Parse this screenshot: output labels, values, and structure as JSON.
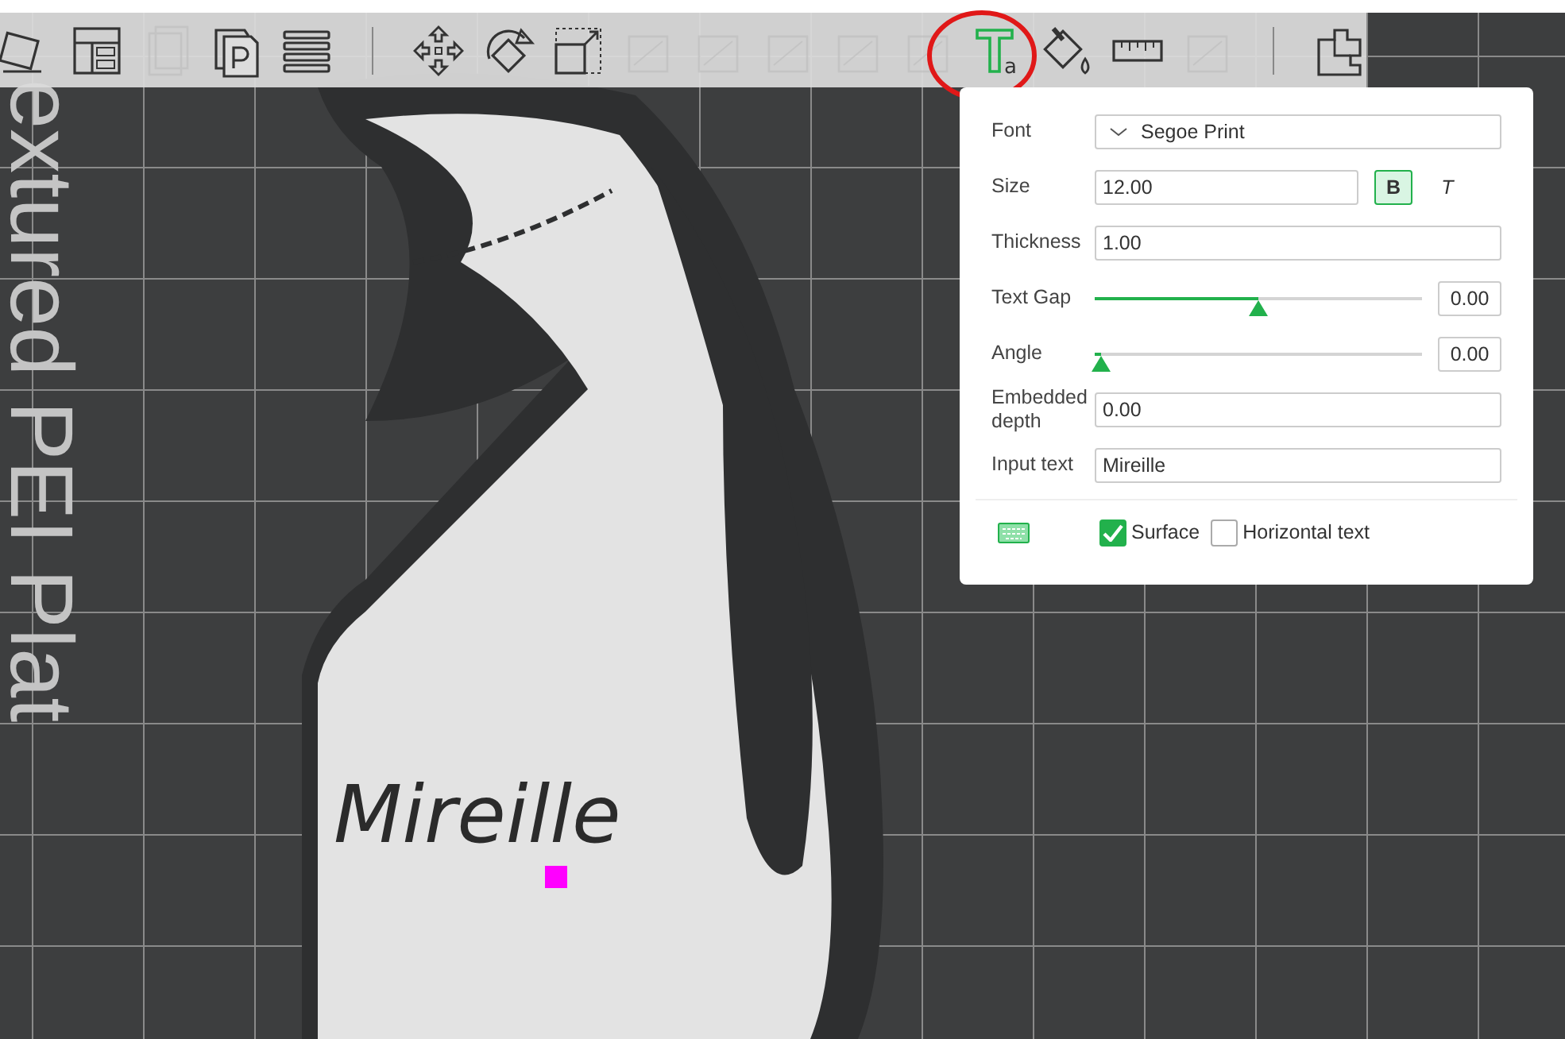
{
  "toolbar": {
    "items": [
      {
        "kind": "tilt",
        "disabled": false,
        "selected": false
      },
      {
        "kind": "layout",
        "disabled": false,
        "selected": false
      },
      {
        "kind": "copy",
        "disabled": true,
        "selected": false
      },
      {
        "kind": "plate",
        "disabled": false,
        "selected": false
      },
      {
        "kind": "layers",
        "disabled": false,
        "selected": false
      },
      {
        "kind": "separator"
      },
      {
        "kind": "move",
        "disabled": false,
        "selected": false
      },
      {
        "kind": "rotate",
        "disabled": false,
        "selected": false
      },
      {
        "kind": "scale",
        "disabled": false,
        "selected": false
      },
      {
        "kind": "flatten",
        "disabled": true,
        "selected": false
      },
      {
        "kind": "split",
        "disabled": true,
        "selected": false
      },
      {
        "kind": "cut",
        "disabled": true,
        "selected": false
      },
      {
        "kind": "support",
        "disabled": true,
        "selected": false
      },
      {
        "kind": "seam",
        "disabled": true,
        "selected": false
      },
      {
        "kind": "text",
        "glyph": "a",
        "disabled": false,
        "selected": true
      },
      {
        "kind": "paint",
        "disabled": false,
        "selected": false
      },
      {
        "kind": "measure",
        "disabled": false,
        "selected": false
      },
      {
        "kind": "assembly",
        "disabled": true,
        "selected": false
      },
      {
        "kind": "separator"
      },
      {
        "kind": "puzzle",
        "disabled": false,
        "selected": false
      }
    ]
  },
  "bed_label": "extured PEI Plat",
  "model_text": "Mireille",
  "text_panel": {
    "rows": [
      {
        "kind": "dropdown",
        "label": "Font",
        "value": "Segoe Print"
      },
      {
        "kind": "size",
        "label": "Size",
        "value": "12.00",
        "bold": {
          "label": "B",
          "selected": true
        },
        "italic": {
          "label": "T",
          "selected": false
        }
      },
      {
        "kind": "field",
        "label": "Thickness",
        "value": "1.00"
      },
      {
        "kind": "slider",
        "label": "Text Gap",
        "level": 0.5,
        "value": "0.00"
      },
      {
        "kind": "slider",
        "label": "Angle",
        "level": 0.02,
        "value": "0.00"
      },
      {
        "kind": "field",
        "label": "Embedded depth",
        "value": "0.00"
      },
      {
        "kind": "field",
        "label": "Input text",
        "value": "Mireille"
      }
    ],
    "options": [
      {
        "label": "Surface",
        "checked": true
      },
      {
        "label": "Horizontal text",
        "checked": false
      }
    ]
  }
}
